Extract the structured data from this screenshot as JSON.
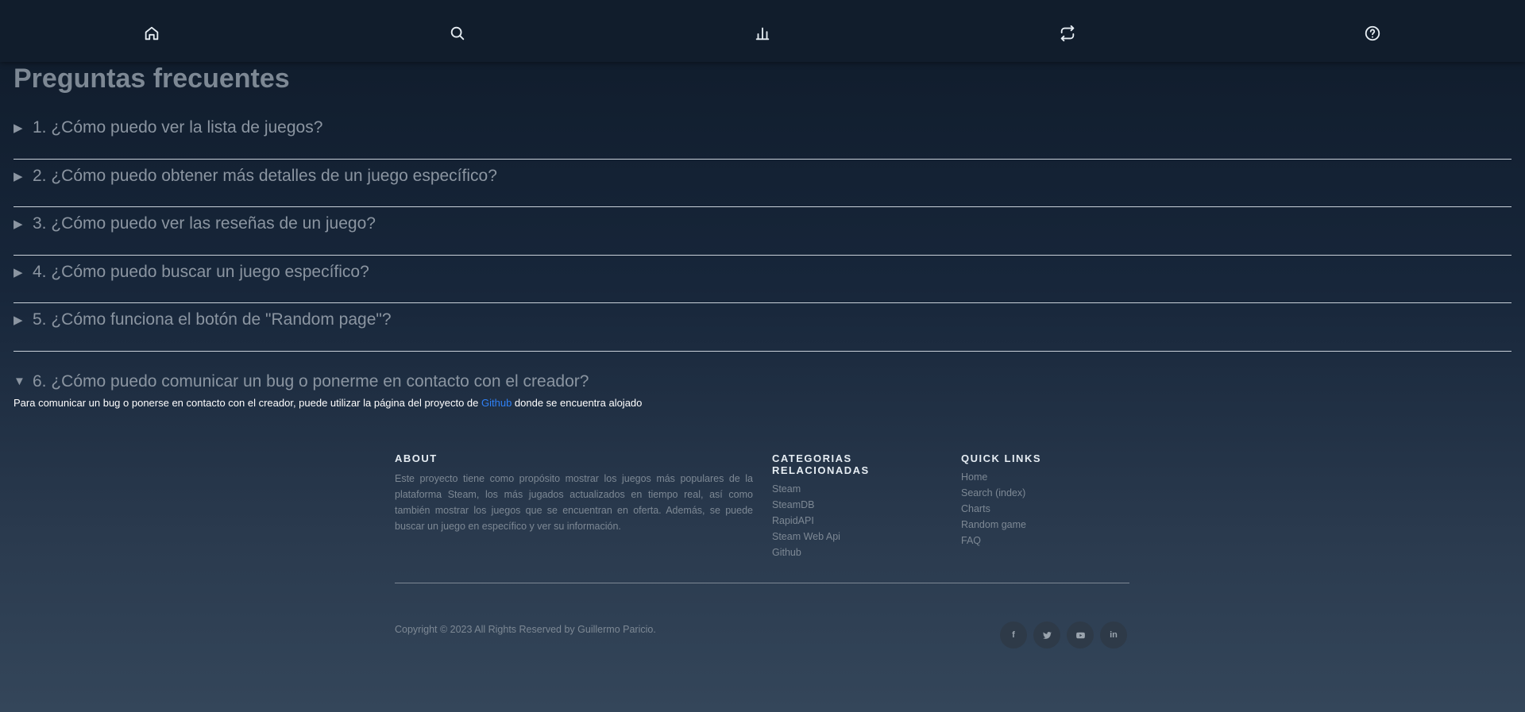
{
  "nav": {
    "items": [
      {
        "icon": "home-icon"
      },
      {
        "icon": "search-icon"
      },
      {
        "icon": "bar-chart-icon"
      },
      {
        "icon": "random-repeat-icon"
      },
      {
        "icon": "help-circle-icon"
      }
    ]
  },
  "page": {
    "title": "Preguntas frecuentes"
  },
  "faq": {
    "items": [
      {
        "question": "1. ¿Cómo puedo ver la lista de juegos?",
        "open": false
      },
      {
        "question": "2. ¿Cómo puedo obtener más detalles de un juego específico?",
        "open": false
      },
      {
        "question": "3. ¿Cómo puedo ver las reseñas de un juego?",
        "open": false
      },
      {
        "question": "4. ¿Cómo puedo buscar un juego específico?",
        "open": false
      },
      {
        "question": "5. ¿Cómo funciona el botón de \"Random page\"?",
        "open": false
      },
      {
        "question": "6. ¿Cómo puedo comunicar un bug o ponerme en contacto con el creador?",
        "open": true,
        "answer_before": "Para comunicar un bug o ponerse en contacto con el creador, puede utilizar la página del proyecto de ",
        "answer_link": "Github",
        "answer_after": " donde se encuentra alojado"
      }
    ]
  },
  "footer": {
    "about": {
      "heading": "ABOUT",
      "text": "Este proyecto tiene como propósito mostrar los juegos más populares de la plataforma Steam, los más jugados actualizados en tiempo real, así como también mostrar los juegos que se encuentran en oferta. Además, se puede buscar un juego en específico y ver su información."
    },
    "categories": {
      "heading_line1": "CATEGORIAS",
      "heading_line2": "RELACIONADAS",
      "links": [
        "Steam",
        "SteamDB",
        "RapidAPI",
        "Steam Web Api",
        "Github"
      ]
    },
    "quick_links": {
      "heading": "QUICK LINKS",
      "links": [
        "Home",
        "Search (index)",
        "Charts",
        "Random game",
        "FAQ"
      ]
    },
    "copyright": "Copyright © 2023 All Rights Reserved by Guillermo Paricio.",
    "social": [
      {
        "icon": "facebook-icon",
        "glyph": "f"
      },
      {
        "icon": "twitter-icon"
      },
      {
        "icon": "youtube-icon"
      },
      {
        "icon": "linkedin-icon",
        "glyph": "in"
      }
    ]
  }
}
